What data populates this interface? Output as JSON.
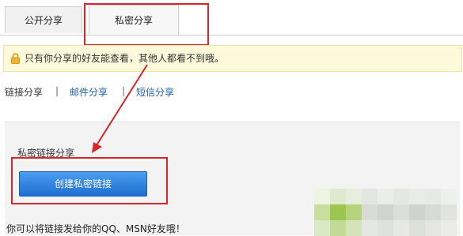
{
  "tabs": {
    "public_label": "公开分享",
    "private_label": "私密分享"
  },
  "notice": {
    "icon": "lock-icon",
    "text": "只有你分享的好友能查看，其他人都看不到哦。"
  },
  "subnav": {
    "link_share": "链接分享",
    "separator": "|",
    "email_share": "邮件分享",
    "sms_share": "短信分享"
  },
  "content": {
    "section_title": "私密链接分享",
    "create_button": "创建私密链接",
    "hint": "你可以将链接发给你的QQ、MSN好友哦！"
  },
  "colors": {
    "highlight": "#d8262a",
    "link": "#1f5fa6",
    "button": "#2a7ad8",
    "notice_bg": "#fff9dc"
  }
}
